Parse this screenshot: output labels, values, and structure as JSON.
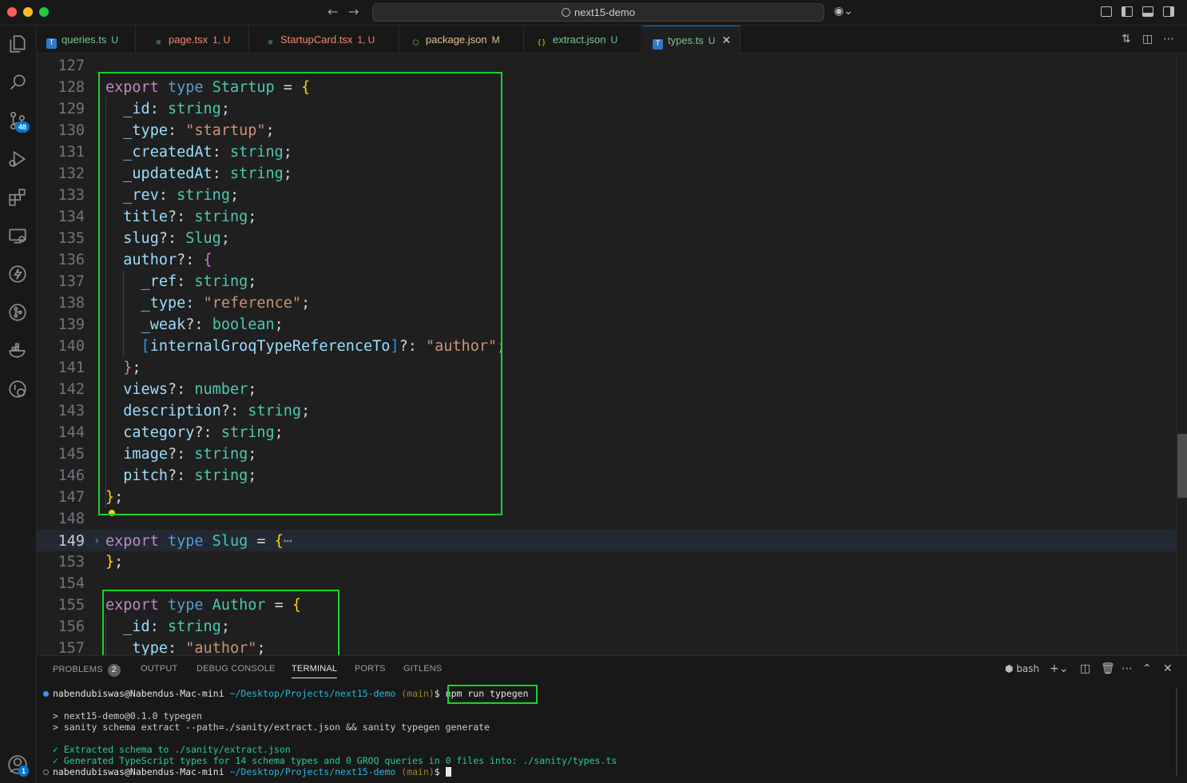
{
  "titlebar": {
    "search_label": "next15-demo",
    "back_icon": "arrow-left-icon",
    "forward_icon": "arrow-right-icon"
  },
  "activity_bar": {
    "items": [
      "explorer",
      "search",
      "source-control",
      "run-debug",
      "extensions",
      "remote-explorer",
      "thunder-client",
      "git-graph",
      "docker",
      "timeline"
    ],
    "source_control_badge": "48",
    "account_badge": "1"
  },
  "tabs": [
    {
      "name": "queries.ts",
      "status": "U",
      "icon": "TS",
      "active": false
    },
    {
      "name": "page.tsx",
      "status": "1, U",
      "icon": "react",
      "active": false
    },
    {
      "name": "StartupCard.tsx",
      "status": "1, U",
      "icon": "react",
      "active": false
    },
    {
      "name": "package.json",
      "status": "M",
      "icon": "node",
      "active": false
    },
    {
      "name": "extract.json",
      "status": "U",
      "icon": "{}",
      "active": false
    },
    {
      "name": "types.ts",
      "status": "U",
      "icon": "TS",
      "active": true
    }
  ],
  "editor": {
    "line_numbers": [
      "127",
      "128",
      "129",
      "130",
      "131",
      "132",
      "133",
      "134",
      "135",
      "136",
      "137",
      "138",
      "139",
      "140",
      "141",
      "142",
      "143",
      "144",
      "145",
      "146",
      "147",
      "148",
      "149",
      "153",
      "154",
      "155",
      "156",
      "157"
    ],
    "current_line": "149",
    "lines": {
      "l128": {
        "kw1": "export",
        "kw2": "type",
        "name": "Startup",
        "op": " = ",
        "brace": "{"
      },
      "l129": {
        "prop": "_id",
        "sep": ": ",
        "type": "string",
        "end": ";"
      },
      "l130": {
        "prop": "_type",
        "sep": ": ",
        "str": "\"startup\"",
        "end": ";"
      },
      "l131": {
        "prop": "_createdAt",
        "sep": ": ",
        "type": "string",
        "end": ";"
      },
      "l132": {
        "prop": "_updatedAt",
        "sep": ": ",
        "type": "string",
        "end": ";"
      },
      "l133": {
        "prop": "_rev",
        "sep": ": ",
        "type": "string",
        "end": ";"
      },
      "l134": {
        "prop": "title",
        "sep": "?: ",
        "type": "string",
        "end": ";"
      },
      "l135": {
        "prop": "slug",
        "sep": "?: ",
        "type": "Slug",
        "end": ";"
      },
      "l136": {
        "prop": "author",
        "sep": "?: ",
        "brace": "{"
      },
      "l137": {
        "prop": "_ref",
        "sep": ": ",
        "type": "string",
        "end": ";"
      },
      "l138": {
        "prop": "_type",
        "sep": ": ",
        "str": "\"reference\"",
        "end": ";"
      },
      "l139": {
        "prop": "_weak",
        "sep": "?: ",
        "type": "boolean",
        "end": ";"
      },
      "l140": {
        "open": "[",
        "prop": "internalGroqTypeReferenceTo",
        "close": "]",
        "sep": "?: ",
        "str": "\"author\"",
        "end": ";"
      },
      "l141": {
        "brace": "}",
        "end": ";"
      },
      "l142": {
        "prop": "views",
        "sep": "?: ",
        "type": "number",
        "end": ";"
      },
      "l143": {
        "prop": "description",
        "sep": "?: ",
        "type": "string",
        "end": ";"
      },
      "l144": {
        "prop": "category",
        "sep": "?: ",
        "type": "string",
        "end": ";"
      },
      "l145": {
        "prop": "image",
        "sep": "?: ",
        "type": "string",
        "end": ";"
      },
      "l146": {
        "prop": "pitch",
        "sep": "?: ",
        "type": "string",
        "end": ";"
      },
      "l147": {
        "brace": "}",
        "end": ";"
      },
      "l149": {
        "kw1": "export",
        "kw2": "type",
        "name": "Slug",
        "op": " = ",
        "brace": "{",
        "ellipsis": "⋯"
      },
      "l153": {
        "brace": "}",
        "end": ";"
      },
      "l155": {
        "kw1": "export",
        "kw2": "type",
        "name": "Author",
        "op": " = ",
        "brace": "{"
      },
      "l156": {
        "prop": "_id",
        "sep": ": ",
        "type": "string",
        "end": ";"
      },
      "l157": {
        "prop": "_type",
        "sep": ": ",
        "str": "\"author\"",
        "end": ";"
      }
    }
  },
  "panel": {
    "tabs": [
      "PROBLEMS",
      "OUTPUT",
      "DEBUG CONSOLE",
      "TERMINAL",
      "PORTS",
      "GITLENS"
    ],
    "active_tab": "TERMINAL",
    "problems_count": "2",
    "shell_label": "bash",
    "terminal": {
      "prompt_user": "nabendubiswas@Nabendus-Mac-mini",
      "prompt_path": "~/Desktop/Projects/next15-demo",
      "prompt_branch": "(main)",
      "prompt_symbol": "$",
      "command": "npm run typegen",
      "out1": "> next15-demo@0.1.0 typegen",
      "out2": "> sanity schema extract --path=./sanity/extract.json && sanity typegen generate",
      "ok1": "✓ Extracted schema to ./sanity/extract.json",
      "ok2": "✓ Generated TypeScript types for 14 schema types and 0 GROQ queries in 0 files into: ./sanity/types.ts"
    }
  },
  "colors": {
    "highlight_box": "#1bd12b",
    "accent": "#0078d4"
  }
}
